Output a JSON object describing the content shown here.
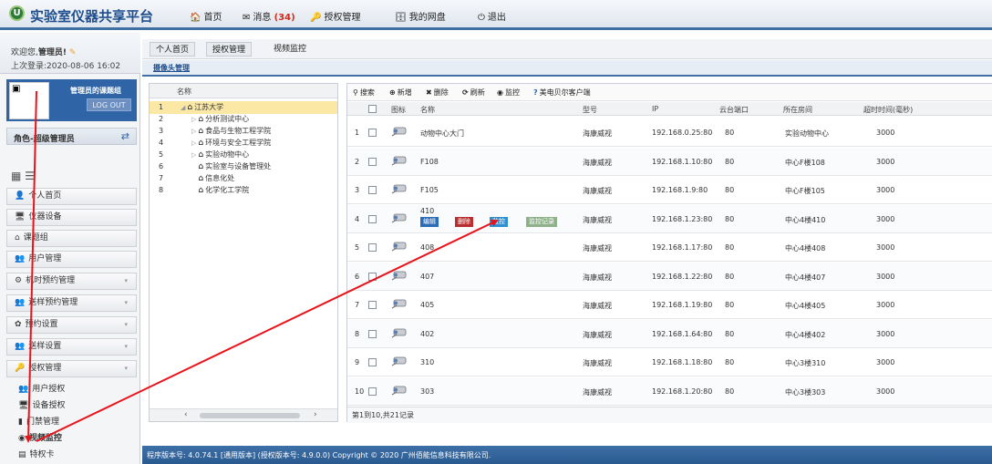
{
  "app": {
    "title": "实验室仪器共享平台",
    "logo_text": "U"
  },
  "topnav": [
    {
      "icon": "home-icon",
      "glyph": "🏠",
      "label": "首页"
    },
    {
      "icon": "mail-icon",
      "glyph": "✉",
      "label": "消息",
      "count": "(34)"
    },
    {
      "icon": "key-icon",
      "glyph": "🔑",
      "label": "授权管理"
    },
    {
      "icon": "disk-icon",
      "glyph": "🗄",
      "label": "我的网盘"
    },
    {
      "icon": "power-icon",
      "glyph": "⏻",
      "label": "退出"
    }
  ],
  "sidebar": {
    "welcome_prefix": "欢迎您,",
    "welcome_user": "管理员!",
    "last_login": "上次登录:2020-08-06 16:02",
    "group_name": "管理员的课题组",
    "logout": "LOG OUT",
    "role": "角色-超级管理员",
    "menu": [
      {
        "label": "个人首页",
        "icon": "user-icon"
      },
      {
        "label": "仪器设备",
        "icon": "monitor-icon"
      },
      {
        "label": "课题组",
        "icon": "group-home-icon"
      },
      {
        "label": "用户管理",
        "icon": "users-icon"
      },
      {
        "label": "机时预约管理",
        "icon": "schedule-icon",
        "arrow": true
      },
      {
        "label": "送样预约管理",
        "icon": "sample-icon",
        "arrow": true
      },
      {
        "label": "预约设置",
        "icon": "settings-icon",
        "arrow": true
      },
      {
        "label": "送样设置",
        "icon": "sample-settings-icon",
        "arrow": true
      },
      {
        "label": "授权管理",
        "icon": "authorize-icon",
        "arrow": true
      }
    ],
    "submenu": [
      {
        "label": "用户授权",
        "icon": "users-icon"
      },
      {
        "label": "设备授权",
        "icon": "monitor-icon"
      },
      {
        "label": "门禁管理",
        "icon": "door-icon"
      },
      {
        "label": "视频监控",
        "icon": "camera-icon"
      },
      {
        "label": "特权卡",
        "icon": "card-icon"
      }
    ]
  },
  "breadcrumb": [
    "个人首页",
    "授权管理",
    "视频监控"
  ],
  "tab": "摄像头管理",
  "tree": {
    "header": "名称",
    "rows": [
      {
        "n": "1",
        "label": "江苏大学",
        "level": 0,
        "expanded": true
      },
      {
        "n": "2",
        "label": "分析测试中心",
        "level": 1
      },
      {
        "n": "3",
        "label": "食品与生物工程学院",
        "level": 1
      },
      {
        "n": "4",
        "label": "环境与安全工程学院",
        "level": 1
      },
      {
        "n": "5",
        "label": "实验动物中心",
        "level": 1
      },
      {
        "n": "6",
        "label": "实验室与设备管理处",
        "level": 1
      },
      {
        "n": "7",
        "label": "信息化处",
        "level": 1
      },
      {
        "n": "8",
        "label": "化学化工学院",
        "level": 1
      }
    ]
  },
  "toolbar": [
    {
      "icon": "search-icon",
      "glyph": "⚲",
      "label": "搜索"
    },
    {
      "icon": "add-icon",
      "glyph": "⊕",
      "label": "新增"
    },
    {
      "icon": "delete-icon",
      "glyph": "✖",
      "label": "删除"
    },
    {
      "icon": "refresh-icon",
      "glyph": "⟳",
      "label": "刷新"
    },
    {
      "icon": "monitor-eye-icon",
      "glyph": "◉",
      "label": "监控"
    },
    {
      "icon": "help-icon",
      "glyph": "?",
      "label": "美电贝尔客户端"
    }
  ],
  "columns": [
    "图标",
    "名称",
    "型号",
    "IP",
    "云台端口",
    "所在房间",
    "超时时间(毫秒)"
  ],
  "rows": [
    {
      "idx": "1",
      "name": "动物中心大门",
      "model": "海康威视",
      "ip": "192.168.0.25:80",
      "port": "80",
      "room": "实验动物中心",
      "timeout": "3000"
    },
    {
      "idx": "2",
      "name": "F108",
      "model": "海康威视",
      "ip": "192.168.1.10:80",
      "port": "80",
      "room": "中心F楼108",
      "timeout": "3000"
    },
    {
      "idx": "3",
      "name": "F105",
      "model": "海康威视",
      "ip": "192.168.1.9:80",
      "port": "80",
      "room": "中心F楼105",
      "timeout": "3000"
    },
    {
      "idx": "4",
      "name": "410",
      "model": "海康威视",
      "ip": "192.168.1.23:80",
      "port": "80",
      "room": "中心4楼410",
      "timeout": "3000"
    },
    {
      "idx": "5",
      "name": "408",
      "model": "海康威视",
      "ip": "192.168.1.17:80",
      "port": "80",
      "room": "中心4楼408",
      "timeout": "3000"
    },
    {
      "idx": "6",
      "name": "407",
      "model": "海康威视",
      "ip": "192.168.1.22:80",
      "port": "80",
      "room": "中心4楼407",
      "timeout": "3000"
    },
    {
      "idx": "7",
      "name": "405",
      "model": "海康威视",
      "ip": "192.168.1.19:80",
      "port": "80",
      "room": "中心4楼405",
      "timeout": "3000"
    },
    {
      "idx": "8",
      "name": "402",
      "model": "海康威视",
      "ip": "192.168.1.64:80",
      "port": "80",
      "room": "中心4楼402",
      "timeout": "3000"
    },
    {
      "idx": "9",
      "name": "310",
      "model": "海康威视",
      "ip": "192.168.1.18:80",
      "port": "80",
      "room": "中心3楼310",
      "timeout": "3000"
    },
    {
      "idx": "10",
      "name": "303",
      "model": "海康威视",
      "ip": "192.168.1.20:80",
      "port": "80",
      "room": "中心3楼303",
      "timeout": "3000"
    }
  ],
  "row_actions": [
    {
      "label": "编辑",
      "icon": "edit-icon",
      "color": "#2b6cb8"
    },
    {
      "label": "删除",
      "icon": "trash-icon",
      "color": "#b92f2f"
    },
    {
      "label": "监控",
      "icon": "monitor-eye-icon",
      "color": "#2f8fd0"
    },
    {
      "label": "监控记录",
      "icon": "log-icon",
      "color": "#8fb18a"
    }
  ],
  "pager": "第1到10,共21记录",
  "footer": "程序版本号: 4.0.74.1 [通用版本] (授权版本号: 4.9.0.0) Copyright © 2020 广州佰能信息科技有限公司.",
  "colors": {
    "brand": "#1f4e8c",
    "accent": "#2f65a6",
    "annotation": "#e8141b"
  }
}
